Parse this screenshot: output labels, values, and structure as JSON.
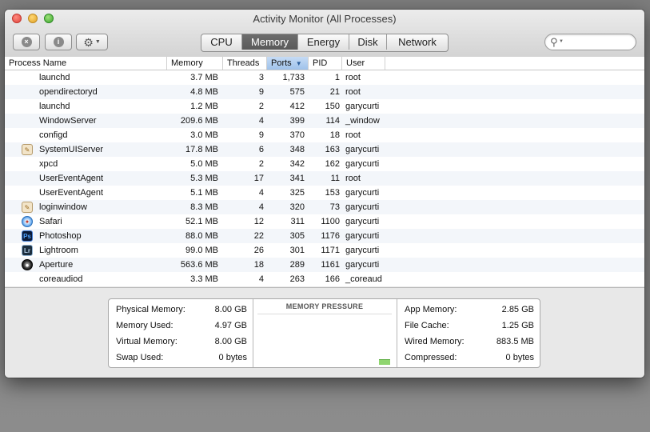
{
  "window": {
    "title": "Activity Monitor (All Processes)"
  },
  "toolbar": {
    "quit_glyph": "×",
    "info_glyph": "i",
    "gear_glyph": "⚙",
    "caret_glyph": "▼"
  },
  "tabs": [
    {
      "label": "CPU",
      "active": false
    },
    {
      "label": "Memory",
      "active": true
    },
    {
      "label": "Energy",
      "active": false
    },
    {
      "label": "Disk",
      "active": false
    },
    {
      "label": "Network",
      "active": false
    }
  ],
  "search": {
    "placeholder": "",
    "value": "",
    "icon": "magnifier-icon"
  },
  "table": {
    "columns": {
      "name": "Process Name",
      "memory": "Memory",
      "threads": "Threads",
      "ports": "Ports",
      "pid": "PID",
      "user": "User"
    },
    "sort_column": "ports",
    "sort_direction": "descending",
    "sort_indicator": "▼",
    "rows": [
      {
        "icon": "",
        "name": "launchd",
        "memory": "3.7 MB",
        "threads": "3",
        "ports": "1,733",
        "pid": "1",
        "user": "root"
      },
      {
        "icon": "",
        "name": "opendirectoryd",
        "memory": "4.8 MB",
        "threads": "9",
        "ports": "575",
        "pid": "21",
        "user": "root"
      },
      {
        "icon": "",
        "name": "launchd",
        "memory": "1.2 MB",
        "threads": "2",
        "ports": "412",
        "pid": "150",
        "user": "garycurti"
      },
      {
        "icon": "",
        "name": "WindowServer",
        "memory": "209.6 MB",
        "threads": "4",
        "ports": "399",
        "pid": "114",
        "user": "_window"
      },
      {
        "icon": "",
        "name": "configd",
        "memory": "3.0 MB",
        "threads": "9",
        "ports": "370",
        "pid": "18",
        "user": "root"
      },
      {
        "icon": "sysui",
        "name": "SystemUIServer",
        "memory": "17.8 MB",
        "threads": "6",
        "ports": "348",
        "pid": "163",
        "user": "garycurti"
      },
      {
        "icon": "",
        "name": "xpcd",
        "memory": "5.0 MB",
        "threads": "2",
        "ports": "342",
        "pid": "162",
        "user": "garycurti"
      },
      {
        "icon": "",
        "name": "UserEventAgent",
        "memory": "5.3 MB",
        "threads": "17",
        "ports": "341",
        "pid": "11",
        "user": "root"
      },
      {
        "icon": "",
        "name": "UserEventAgent",
        "memory": "5.1 MB",
        "threads": "4",
        "ports": "325",
        "pid": "153",
        "user": "garycurti"
      },
      {
        "icon": "login",
        "name": "loginwindow",
        "memory": "8.3 MB",
        "threads": "4",
        "ports": "320",
        "pid": "73",
        "user": "garycurti"
      },
      {
        "icon": "safari",
        "name": "Safari",
        "memory": "52.1 MB",
        "threads": "12",
        "ports": "311",
        "pid": "1100",
        "user": "garycurti"
      },
      {
        "icon": "ps",
        "name": "Photoshop",
        "memory": "88.0 MB",
        "threads": "22",
        "ports": "305",
        "pid": "1176",
        "user": "garycurti"
      },
      {
        "icon": "lr",
        "name": "Lightroom",
        "memory": "99.0 MB",
        "threads": "26",
        "ports": "301",
        "pid": "1171",
        "user": "garycurti"
      },
      {
        "icon": "aperture",
        "name": "Aperture",
        "memory": "563.6 MB",
        "threads": "18",
        "ports": "289",
        "pid": "1161",
        "user": "garycurti"
      },
      {
        "icon": "",
        "name": "coreaudiod",
        "memory": "3.3 MB",
        "threads": "4",
        "ports": "263",
        "pid": "166",
        "user": "_coreaud"
      }
    ]
  },
  "icon_glyphs": {
    "sysui": "✎",
    "login": "✎",
    "safari": "✦",
    "ps": "Ps",
    "lr": "Lr",
    "aperture": "●"
  },
  "memory_stats": {
    "left": [
      {
        "label": "Physical Memory:",
        "value": "8.00 GB"
      },
      {
        "label": "Memory Used:",
        "value": "4.97 GB"
      },
      {
        "label": "Virtual Memory:",
        "value": "8.00 GB"
      },
      {
        "label": "Swap Used:",
        "value": "0 bytes"
      }
    ],
    "pressure_title": "MEMORY PRESSURE",
    "pressure_color": "#8fd56f",
    "right": [
      {
        "label": "App Memory:",
        "value": "2.85 GB"
      },
      {
        "label": "File Cache:",
        "value": "1.25 GB"
      },
      {
        "label": "Wired Memory:",
        "value": "883.5 MB"
      },
      {
        "label": "Compressed:",
        "value": "0 bytes"
      }
    ]
  }
}
